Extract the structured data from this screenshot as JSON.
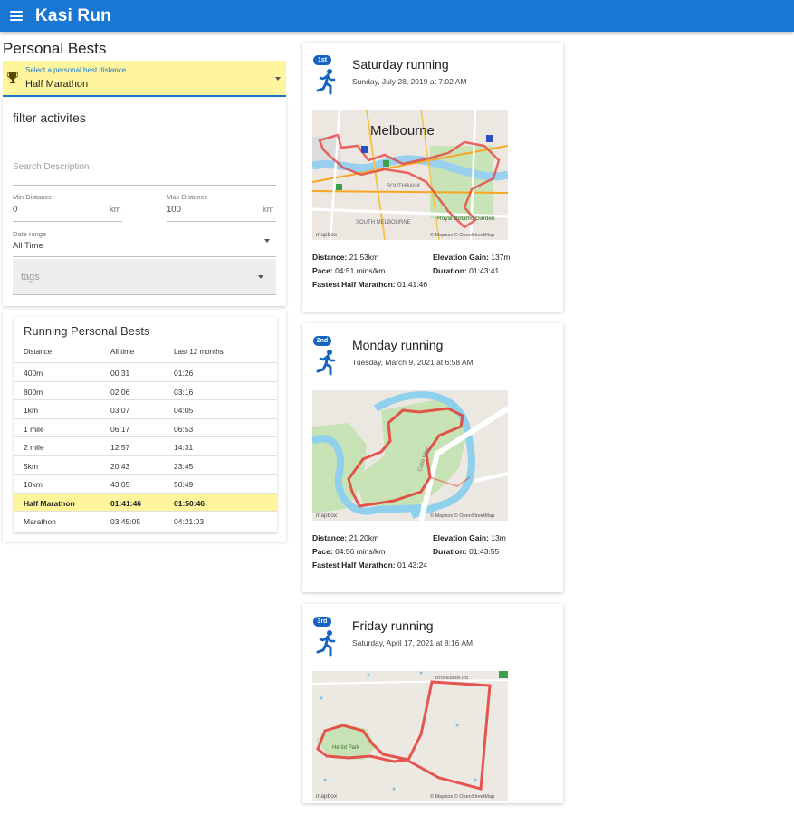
{
  "app": {
    "title": "Kasi Run"
  },
  "page": {
    "title": "Personal Bests"
  },
  "pb_select": {
    "label": "Select a personal best distance",
    "value": "Half Marathon",
    "icon": "trophy-icon"
  },
  "filter": {
    "title": "filter activites",
    "search_placeholder": "Search Description",
    "min_distance": {
      "label": "Min Distance",
      "value": "0",
      "unit": "km"
    },
    "max_distance": {
      "label": "Max Distance",
      "value": "100",
      "unit": "km"
    },
    "date_range": {
      "label": "Date range",
      "value": "All Time"
    },
    "tags_label": "tags"
  },
  "pb_table": {
    "title": "Running Personal Bests",
    "columns": [
      "Distance",
      "All time",
      "Last 12 months"
    ],
    "rows": [
      {
        "distance": "400m",
        "all_time": "00:31",
        "last12": "01:26"
      },
      {
        "distance": "800m",
        "all_time": "02:06",
        "last12": "03:16"
      },
      {
        "distance": "1km",
        "all_time": "03:07",
        "last12": "04:05"
      },
      {
        "distance": "1 mile",
        "all_time": "06:17",
        "last12": "06:53"
      },
      {
        "distance": "2 mile",
        "all_time": "12:57",
        "last12": "14:31"
      },
      {
        "distance": "5km",
        "all_time": "20:43",
        "last12": "23:45"
      },
      {
        "distance": "10km",
        "all_time": "43:05",
        "last12": "50:49"
      },
      {
        "distance": "Half Marathon",
        "all_time": "01:41:46",
        "last12": "01:50:46"
      },
      {
        "distance": "Marathon",
        "all_time": "03:45:05",
        "last12": "04:21:03"
      }
    ],
    "highlight_color": "#fff59d"
  },
  "activities": [
    {
      "rank": "1st",
      "title": "Saturday running",
      "date": "Sunday, July 28, 2019 at 7:02 AM",
      "distance": "21.53km",
      "elevation": "137m",
      "pace": "04:51 mins/km",
      "duration": "01:43:41",
      "fastest": "01:41:46",
      "map": {
        "city": "Melbourne",
        "area1": "SOUTHBANK",
        "area2": "SOUTH MELBOURNE",
        "garden": "Royal Botanic Garden",
        "attribution": "© Mapbox © OpenStreetMap",
        "logo": "mapbox"
      }
    },
    {
      "rank": "2nd",
      "title": "Monday running",
      "date": "Tuesday, March 9, 2021 at 6:58 AM",
      "distance": "21.20km",
      "elevation": "13m",
      "pace": "04:56 mins/km",
      "duration": "01:43:55",
      "fastest": "01:43:24",
      "map": {
        "road": "Cobb Way",
        "attribution": "© Mapbox © OpenStreetMap",
        "logo": "mapbox"
      }
    },
    {
      "rank": "3rd",
      "title": "Friday running",
      "date": "Saturday, April 17, 2021 at 8:16 AM",
      "map": {
        "road": "Brooklands Rd",
        "park": "Heriot Park",
        "attribution": "© Mapbox © OpenStreetMap",
        "logo": "mapbox"
      }
    }
  ],
  "labels": {
    "distance": "Distance:",
    "elevation": "Elevation Gain:",
    "pace": "Pace:",
    "duration": "Duration:",
    "fastest_half": "Fastest Half Marathon:"
  },
  "colors": {
    "appbar": "#1976d2",
    "route": "#e53935",
    "badge": "#1565c0"
  }
}
